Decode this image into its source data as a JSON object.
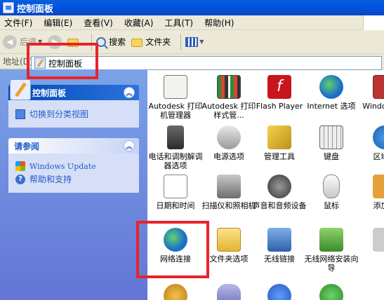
{
  "window": {
    "title": "控制面板"
  },
  "menu": [
    "文件(F)",
    "编辑(E)",
    "查看(V)",
    "收藏(A)",
    "工具(T)",
    "帮助(H)"
  ],
  "toolbar": {
    "back": "后退",
    "search": "搜索",
    "folders": "文件夹"
  },
  "address": {
    "label": "地址(D)",
    "value": "控制面板"
  },
  "sidebar": {
    "panel1": {
      "title": "控制面板",
      "link": "切换到分类视图"
    },
    "panel2": {
      "title": "请参阅",
      "links": [
        "Windows Update",
        "帮助和支持"
      ]
    }
  },
  "items": [
    {
      "label": "Autodesk 打印机管理器",
      "icon": "printer-manager-icon"
    },
    {
      "label": "Autodesk 打印样式管...",
      "icon": "plot-style-icon"
    },
    {
      "label": "Flash Player",
      "icon": "flash-icon"
    },
    {
      "label": "Internet 选项",
      "icon": "internet-options-icon"
    },
    {
      "label": "Windows 火",
      "icon": "firewall-icon"
    },
    {
      "label": "电话和调制解调器选项",
      "icon": "phone-modem-icon"
    },
    {
      "label": "电源选项",
      "icon": "power-icon"
    },
    {
      "label": "管理工具",
      "icon": "admin-tools-icon"
    },
    {
      "label": "键盘",
      "icon": "keyboard-icon"
    },
    {
      "label": "区域和",
      "icon": "region-icon"
    },
    {
      "label": "日期和时间",
      "icon": "datetime-icon"
    },
    {
      "label": "扫描仪和照相机",
      "icon": "scanner-icon"
    },
    {
      "label": "声音和音频设备",
      "icon": "sound-icon"
    },
    {
      "label": "鼠标",
      "icon": "mouse-icon"
    },
    {
      "label": "添加或",
      "icon": "add-remove-icon"
    },
    {
      "label": "网络连接",
      "icon": "network-icon"
    },
    {
      "label": "文件夹选项",
      "icon": "folder-options-icon"
    },
    {
      "label": "无线链接",
      "icon": "wireless-link-icon"
    },
    {
      "label": "无线网络安装向导",
      "icon": "wireless-wizard-icon"
    },
    {
      "label": "",
      "icon": "extra-icon"
    }
  ]
}
